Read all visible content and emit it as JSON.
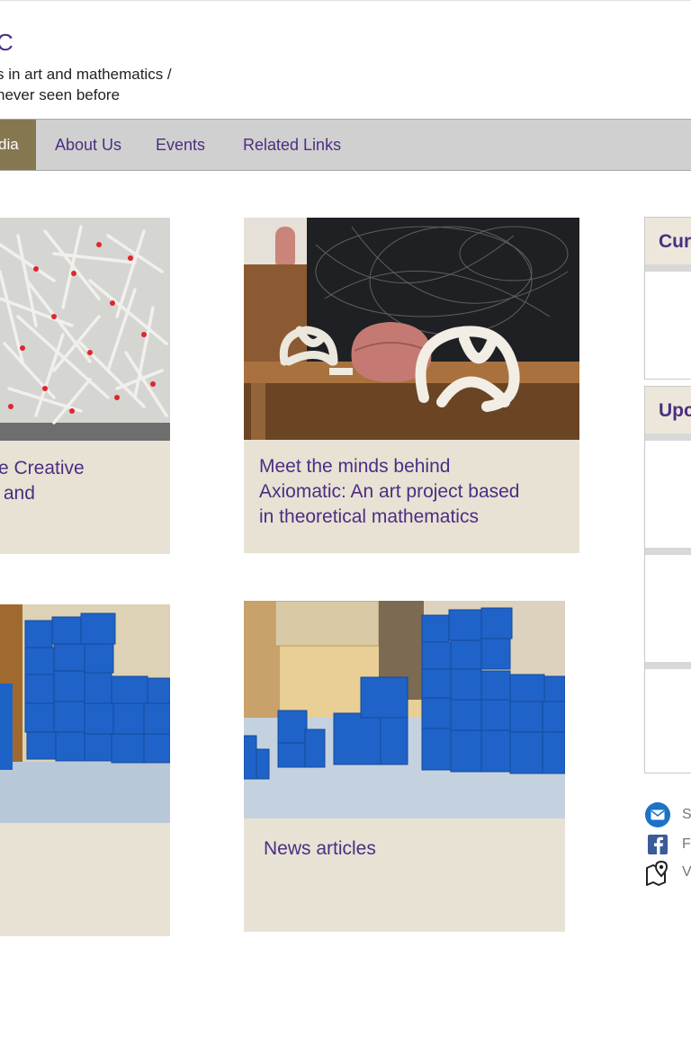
{
  "header": {
    "brand": "C",
    "tagline": "s in art and mathematics /\nnever seen before"
  },
  "nav": {
    "active_label": "dia",
    "items": [
      "About Us",
      "Events",
      "Related Links"
    ]
  },
  "cards": [
    {
      "title": "e Creative\n and"
    },
    {
      "title": "Meet the minds behind\nAxiomatic: An art project based\nin theoretical mathematics"
    },
    {
      "title": ""
    },
    {
      "title": "News articles"
    }
  ],
  "sidebar": {
    "panel1_title": "Cur",
    "panel2_title": "Upc"
  },
  "social": {
    "email_label": "S",
    "facebook_label": "F",
    "map_label": "V"
  },
  "colors": {
    "accent": "#4b2e83",
    "nav_active": "#857750",
    "card_bg": "#e8e2d4",
    "nav_bg": "#d1d0d0"
  }
}
